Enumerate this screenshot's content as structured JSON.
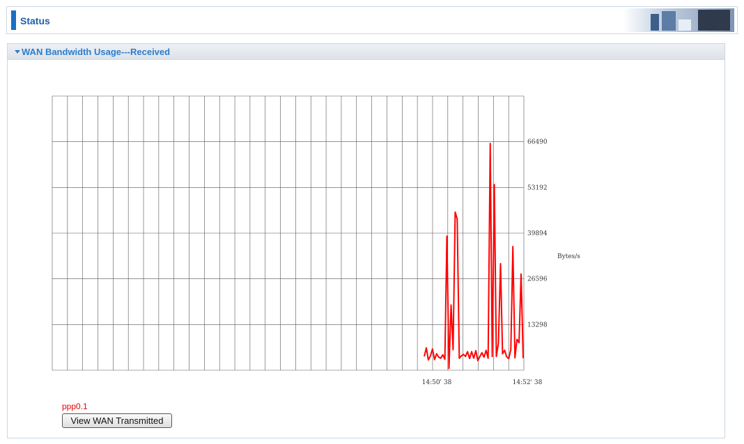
{
  "header": {
    "title": "Status"
  },
  "panel": {
    "title": "WAN Bandwidth Usage---Received"
  },
  "chart_data": {
    "type": "line",
    "y_unit_label": "Bytes/s",
    "y_ticks": [
      13298,
      26596,
      39894,
      53192,
      66490
    ],
    "ylim": [
      0,
      79788
    ],
    "x_tick_labels": [
      "14:50' 38",
      "14:52' 38"
    ],
    "grid": true,
    "series": [
      {
        "name": "ppp0.1",
        "color": "#ff0000",
        "values": [
          4000,
          6500,
          3000,
          4200,
          6200,
          3100,
          4800,
          3800,
          3500,
          4500,
          3200,
          39000,
          500,
          19000,
          6000,
          46000,
          44000,
          3500,
          4200,
          4600,
          4000,
          5400,
          3400,
          5400,
          3500,
          5700,
          2800,
          4000,
          5100,
          3800,
          5800,
          3500,
          66000,
          4000,
          54000,
          4000,
          8000,
          31000,
          4800,
          5800,
          3900,
          3400,
          6000,
          36000,
          3600,
          9000,
          8000,
          28000,
          3500
        ]
      }
    ]
  },
  "legend": {
    "interface": "ppp0.1"
  },
  "buttons": {
    "view_transmitted": "View WAN Transmitted"
  }
}
